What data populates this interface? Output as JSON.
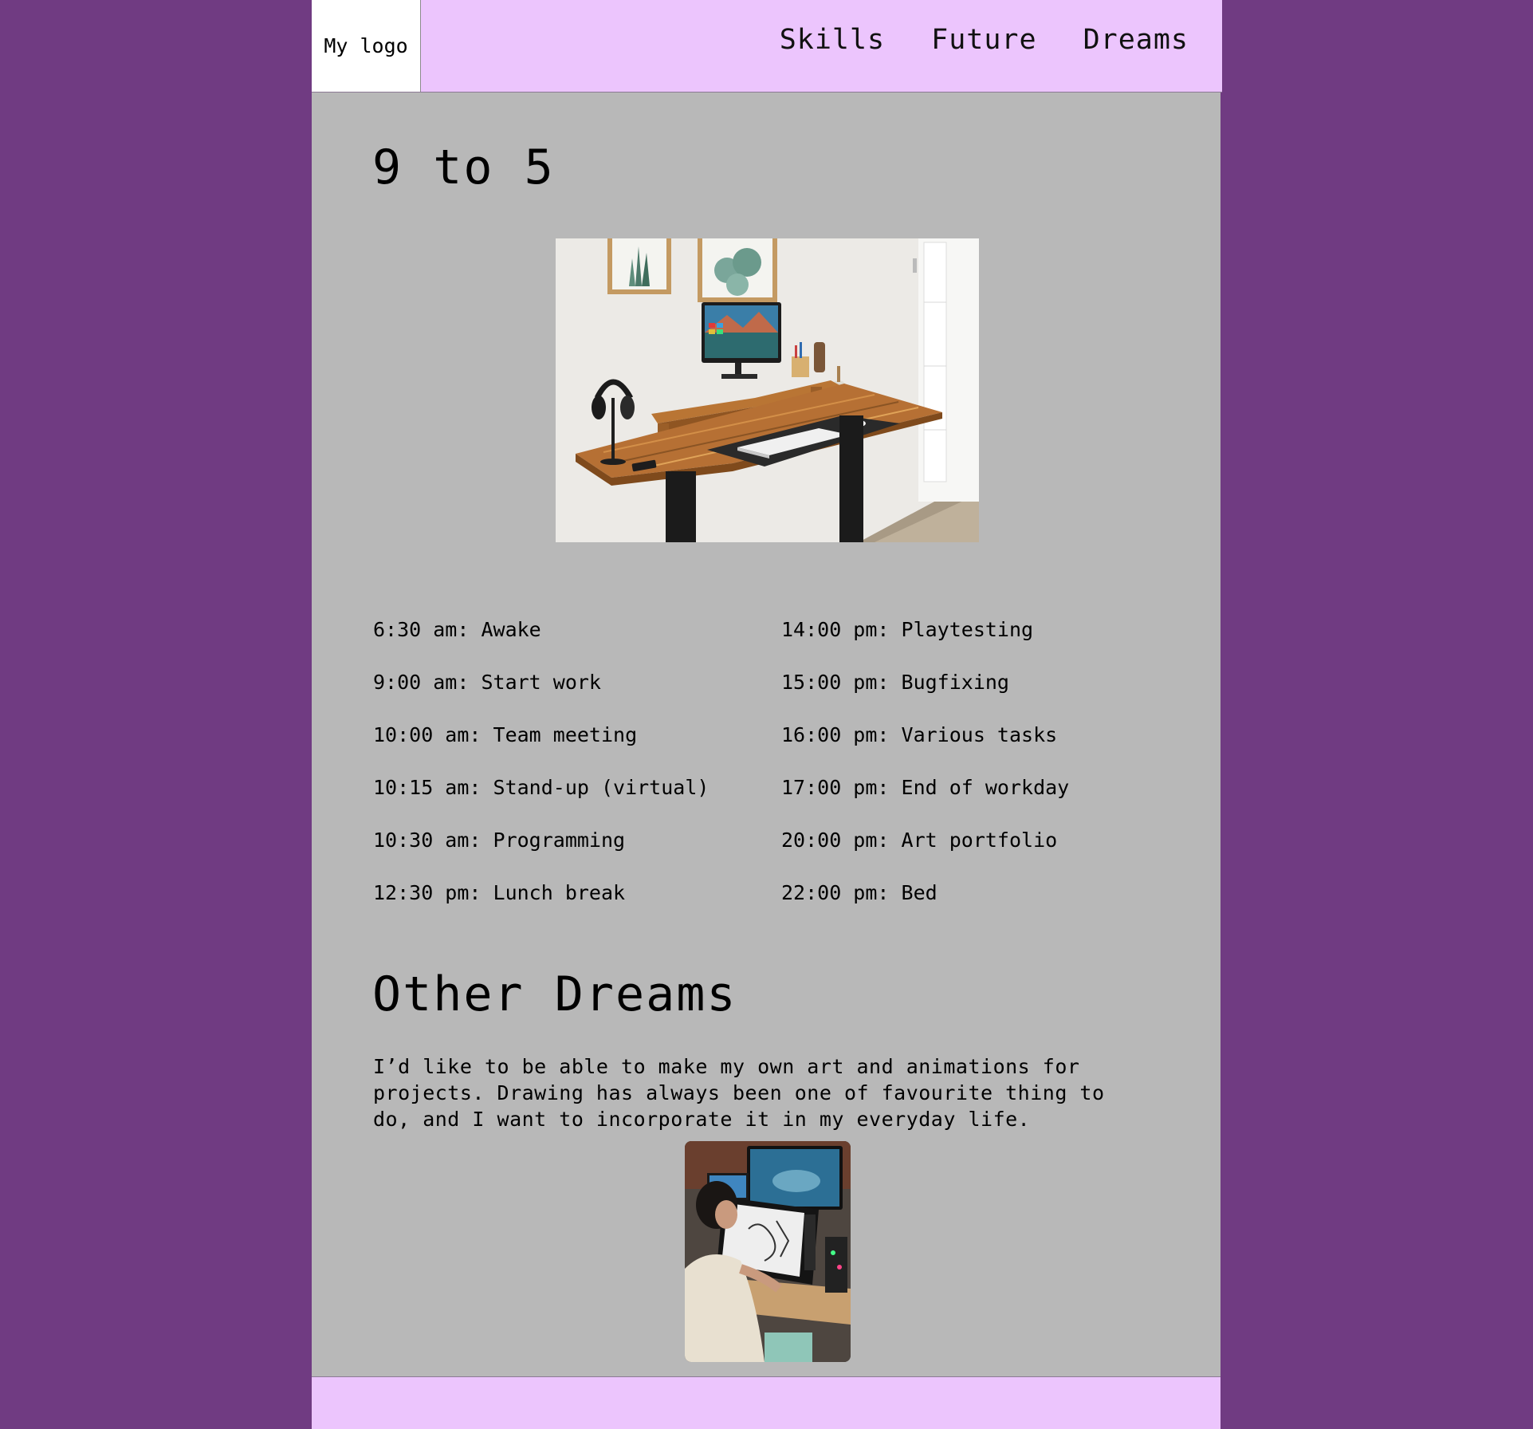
{
  "header": {
    "logo": "My logo",
    "nav": [
      "Skills",
      "Future",
      "Dreams"
    ]
  },
  "main": {
    "section1_title": "9 to 5",
    "desk_image_alt": "desk-photo",
    "schedule_left": [
      "6:30 am: Awake",
      "9:00 am: Start work",
      "10:00 am: Team meeting",
      "10:15 am: Stand-up (virtual)",
      "10:30 am: Programming",
      "12:30 pm: Lunch break"
    ],
    "schedule_right": [
      "14:00 pm: Playtesting",
      "15:00 pm: Bugfixing",
      "16:00 pm: Various tasks",
      "17:00 pm: End of workday",
      "20:00 pm: Art portfolio",
      "22:00 pm: Bed"
    ],
    "section2_title": "Other Dreams",
    "section2_text": "I’d like to be able to make my own art and animations for projects. Drawing has always been one of favourite thing to do, and I want to incorporate it in my everyday life."
  },
  "colors": {
    "background": "#703b82",
    "header_footer": "#ecc5fd",
    "content": "#b8b8b8",
    "logo_bg": "#ffffff"
  }
}
